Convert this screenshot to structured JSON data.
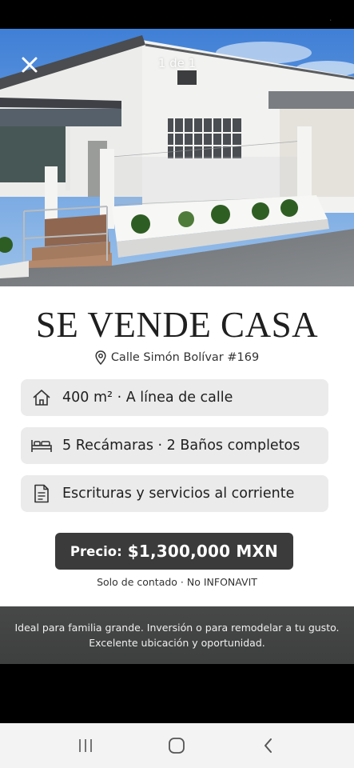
{
  "status": {
    "indicator": "·"
  },
  "viewer": {
    "counter": "1 de 1",
    "close_icon": "close-icon"
  },
  "listing": {
    "title": "SE VENDE CASA",
    "address": "Calle Simón Bolívar #169",
    "features": [
      {
        "icon": "house-icon",
        "text": "400 m² · A línea de calle"
      },
      {
        "icon": "bed-icon",
        "text": "5 Recámaras · 2 Baños completos"
      },
      {
        "icon": "document-icon",
        "text": "Escrituras y servicios al corriente"
      }
    ],
    "price_label": "Precio:",
    "price_amount": "$1,300,000 MXN",
    "terms": "Solo de contado · No INFONAVIT",
    "banner_line1": "Ideal para familia grande. Inversión o para remodelar a tu gusto.",
    "banner_line2": "Excelente ubicación y oportunidad."
  },
  "navigation": {
    "recents_icon": "recents-icon",
    "home_icon": "home-icon",
    "back_icon": "back-icon"
  },
  "colors": {
    "price_background": "#3b3b3b",
    "feature_background": "#ebebeb",
    "banner_background": "#444545"
  }
}
